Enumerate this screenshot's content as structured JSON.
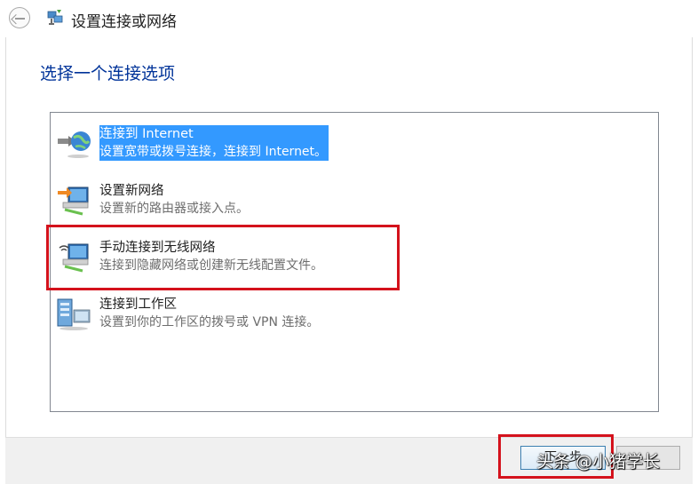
{
  "window": {
    "title": "设置连接或网络"
  },
  "page": {
    "heading": "选择一个连接选项"
  },
  "options": [
    {
      "label": "连接到 Internet",
      "desc": "设置宽带或拨号连接，连接到 Internet。",
      "icon": "globe-network-icon",
      "selected": true
    },
    {
      "label": "设置新网络",
      "desc": "设置新的路由器或接入点。",
      "icon": "new-network-icon",
      "selected": false
    },
    {
      "label": "手动连接到无线网络",
      "desc": "连接到隐藏网络或创建新无线配置文件。",
      "icon": "wireless-network-icon",
      "selected": false
    },
    {
      "label": "连接到工作区",
      "desc": "设置到你的工作区的拨号或 VPN 连接。",
      "icon": "workplace-icon",
      "selected": false
    }
  ],
  "footer": {
    "next_label": "下一步",
    "cancel_label": ""
  },
  "watermark": "头条 @小猪学长",
  "colors": {
    "heading": "#003399",
    "selection": "#3399ff",
    "annotation": "#d4121c"
  }
}
